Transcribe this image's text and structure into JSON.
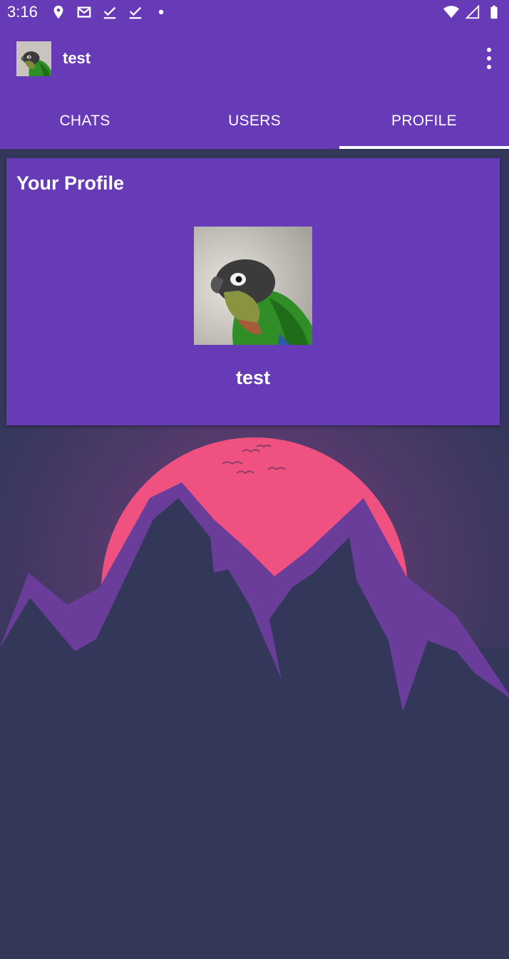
{
  "status_bar": {
    "time": "3:16",
    "left_icons": [
      "location-icon",
      "gmail-icon",
      "check-icon",
      "check-icon",
      "dot-icon"
    ],
    "right_icons": [
      "wifi-icon",
      "signal-icon",
      "battery-icon"
    ]
  },
  "toolbar": {
    "title": "test",
    "avatar_icon": "parrot-avatar",
    "menu_icon": "overflow-menu-icon"
  },
  "tabs": [
    {
      "label": "CHATS",
      "selected": false
    },
    {
      "label": "USERS",
      "selected": false
    },
    {
      "label": "PROFILE",
      "selected": true
    }
  ],
  "profile": {
    "title": "Your Profile",
    "name": "test",
    "image": "parrot-photo"
  },
  "colors": {
    "primary": "#673ab7",
    "background": "#33375a",
    "sun": "#ef5281",
    "mountain_light": "#6a3d9a"
  }
}
